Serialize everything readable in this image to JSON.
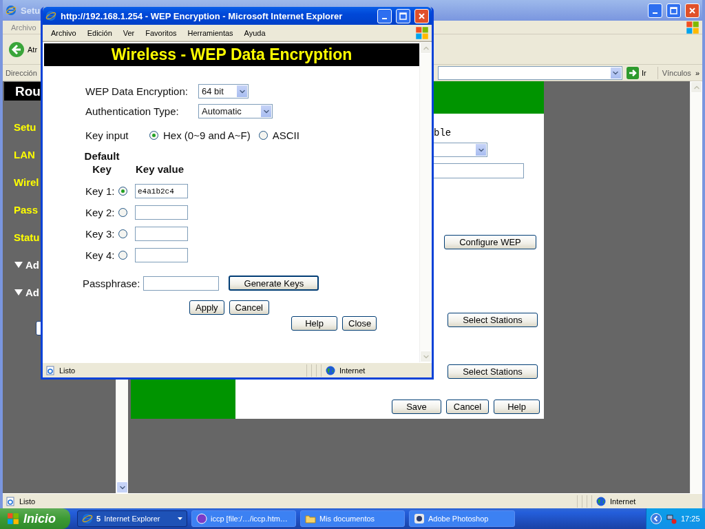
{
  "browser": {
    "title": "Setu",
    "menu": [
      "Archivo"
    ],
    "back_label": "Atr",
    "address_label": "Dirección",
    "go_label": "Ir",
    "links_label": "Vínculos",
    "links_more": "»",
    "router_page": {
      "header": "Rou",
      "nav": [
        {
          "label": "Setu",
          "kind": "link"
        },
        {
          "label": "LAN",
          "kind": "link"
        },
        {
          "label": "Wirel",
          "kind": "link"
        },
        {
          "label": "Pass",
          "kind": "link"
        },
        {
          "label": "Statu",
          "kind": "link"
        },
        {
          "label": "Ad",
          "kind": "group"
        },
        {
          "label": "Ad",
          "kind": "group"
        }
      ],
      "fragment_text": "ble",
      "configure_button": "Configure WEP",
      "station_buttons": [
        "Select Stations",
        "Select Stations"
      ],
      "actions": [
        "Save",
        "Cancel",
        "Help"
      ]
    },
    "status": {
      "text": "Listo",
      "zone": "Internet"
    }
  },
  "popup": {
    "title": "http://192.168.1.254 - WEP Encryption - Microsoft Internet Explorer",
    "menu": [
      "Archivo",
      "Edición",
      "Ver",
      "Favoritos",
      "Herramientas",
      "Ayuda"
    ],
    "header": "Wireless - WEP Data Encryption",
    "encryption": {
      "label": "WEP Data Encryption:",
      "value": "64 bit"
    },
    "auth": {
      "label": "Authentication Type:",
      "value": "Automatic"
    },
    "key_input": {
      "label": "Key input",
      "options": [
        {
          "label": "Hex (0~9 and A~F)",
          "selected": true
        },
        {
          "label": "ASCII",
          "selected": false
        }
      ]
    },
    "key_columns": [
      "Default Key",
      "Key value"
    ],
    "keys": [
      {
        "label": "Key 1:",
        "selected": true,
        "value": "e4a1b2c4"
      },
      {
        "label": "Key 2:",
        "selected": false
      },
      {
        "label": "Key 3:",
        "selected": false
      },
      {
        "label": "Key 4:",
        "selected": false
      }
    ],
    "passphrase_label": "Passphrase:",
    "generate_button": "Generate Keys",
    "form_buttons": [
      "Apply",
      "Cancel"
    ],
    "window_buttons": [
      "Help",
      "Close"
    ],
    "status": {
      "text": "Listo",
      "zone": "Internet"
    }
  },
  "taskbar": {
    "start": "Inicio",
    "items": [
      {
        "label": "Internet Explorer",
        "count": "5",
        "kind": "browser",
        "selected": true
      },
      {
        "label": "iccp [file:/…/iccp.htm…",
        "kind": "player",
        "selected": false
      },
      {
        "label": "Mis documentos",
        "kind": "folder",
        "selected": false
      },
      {
        "label": "Adobe Photoshop",
        "kind": "app",
        "selected": false
      }
    ],
    "clock": "17:25"
  }
}
